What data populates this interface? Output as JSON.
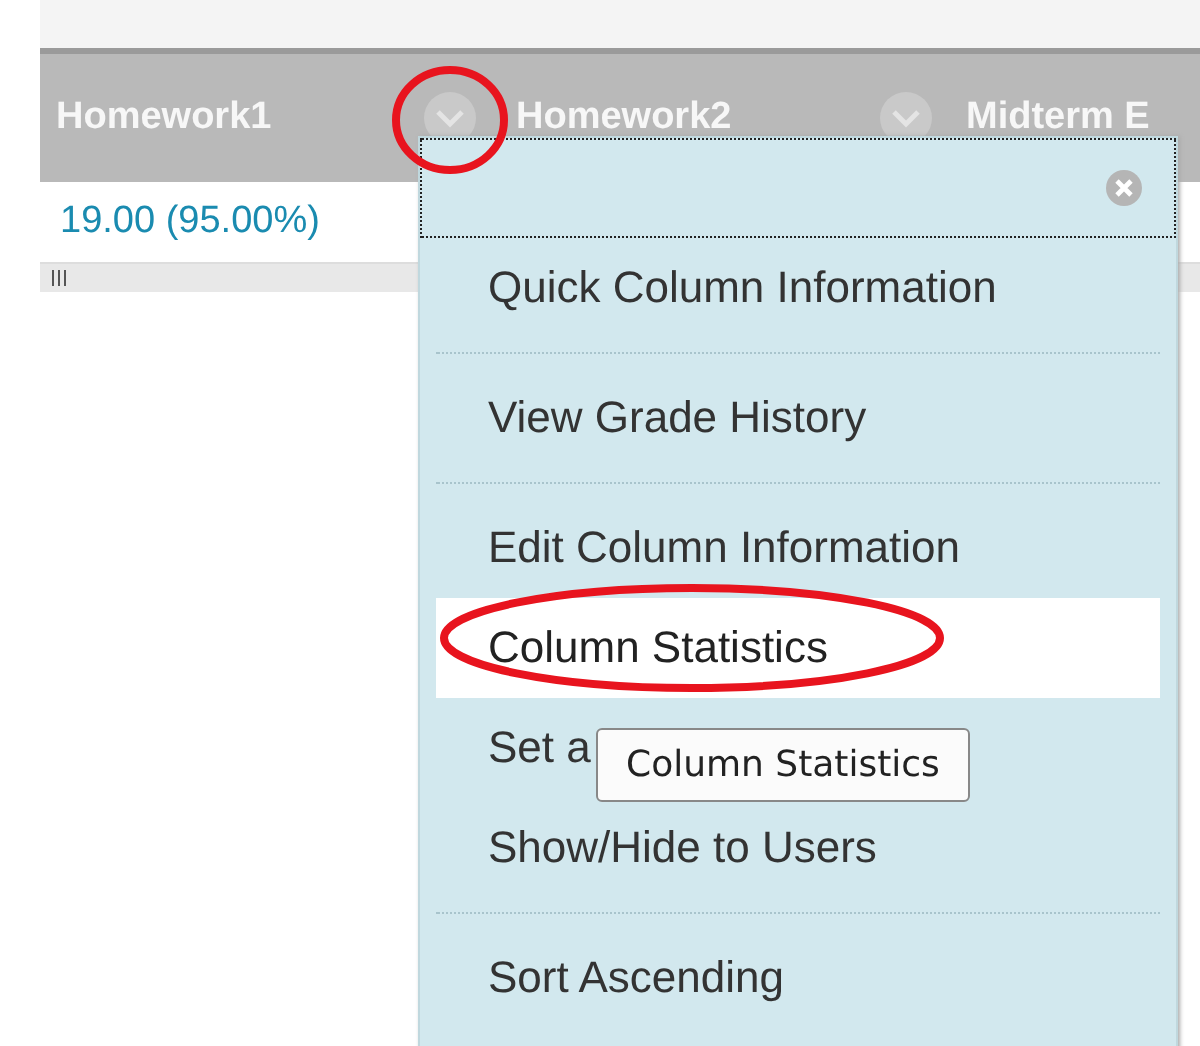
{
  "grid": {
    "columns": [
      {
        "label": "Homework1"
      },
      {
        "label": "Homework2"
      },
      {
        "label": "Midterm E"
      }
    ],
    "cell": "19.00 (95.00%)"
  },
  "menu": {
    "items": [
      {
        "label": "Quick Column Information",
        "selected": false,
        "divider_after": true
      },
      {
        "label": "View Grade History",
        "selected": false,
        "divider_after": true
      },
      {
        "label": "Edit Column Information",
        "selected": false,
        "divider_after": false
      },
      {
        "label": "Column Statistics",
        "selected": true,
        "divider_after": false
      },
      {
        "label": "Set a",
        "selected": false,
        "divider_after": false
      },
      {
        "label": "Show/Hide to Users",
        "selected": false,
        "divider_after": true
      },
      {
        "label": "Sort Ascending",
        "selected": false,
        "divider_after": false
      }
    ]
  },
  "tooltip": "Column Statistics"
}
